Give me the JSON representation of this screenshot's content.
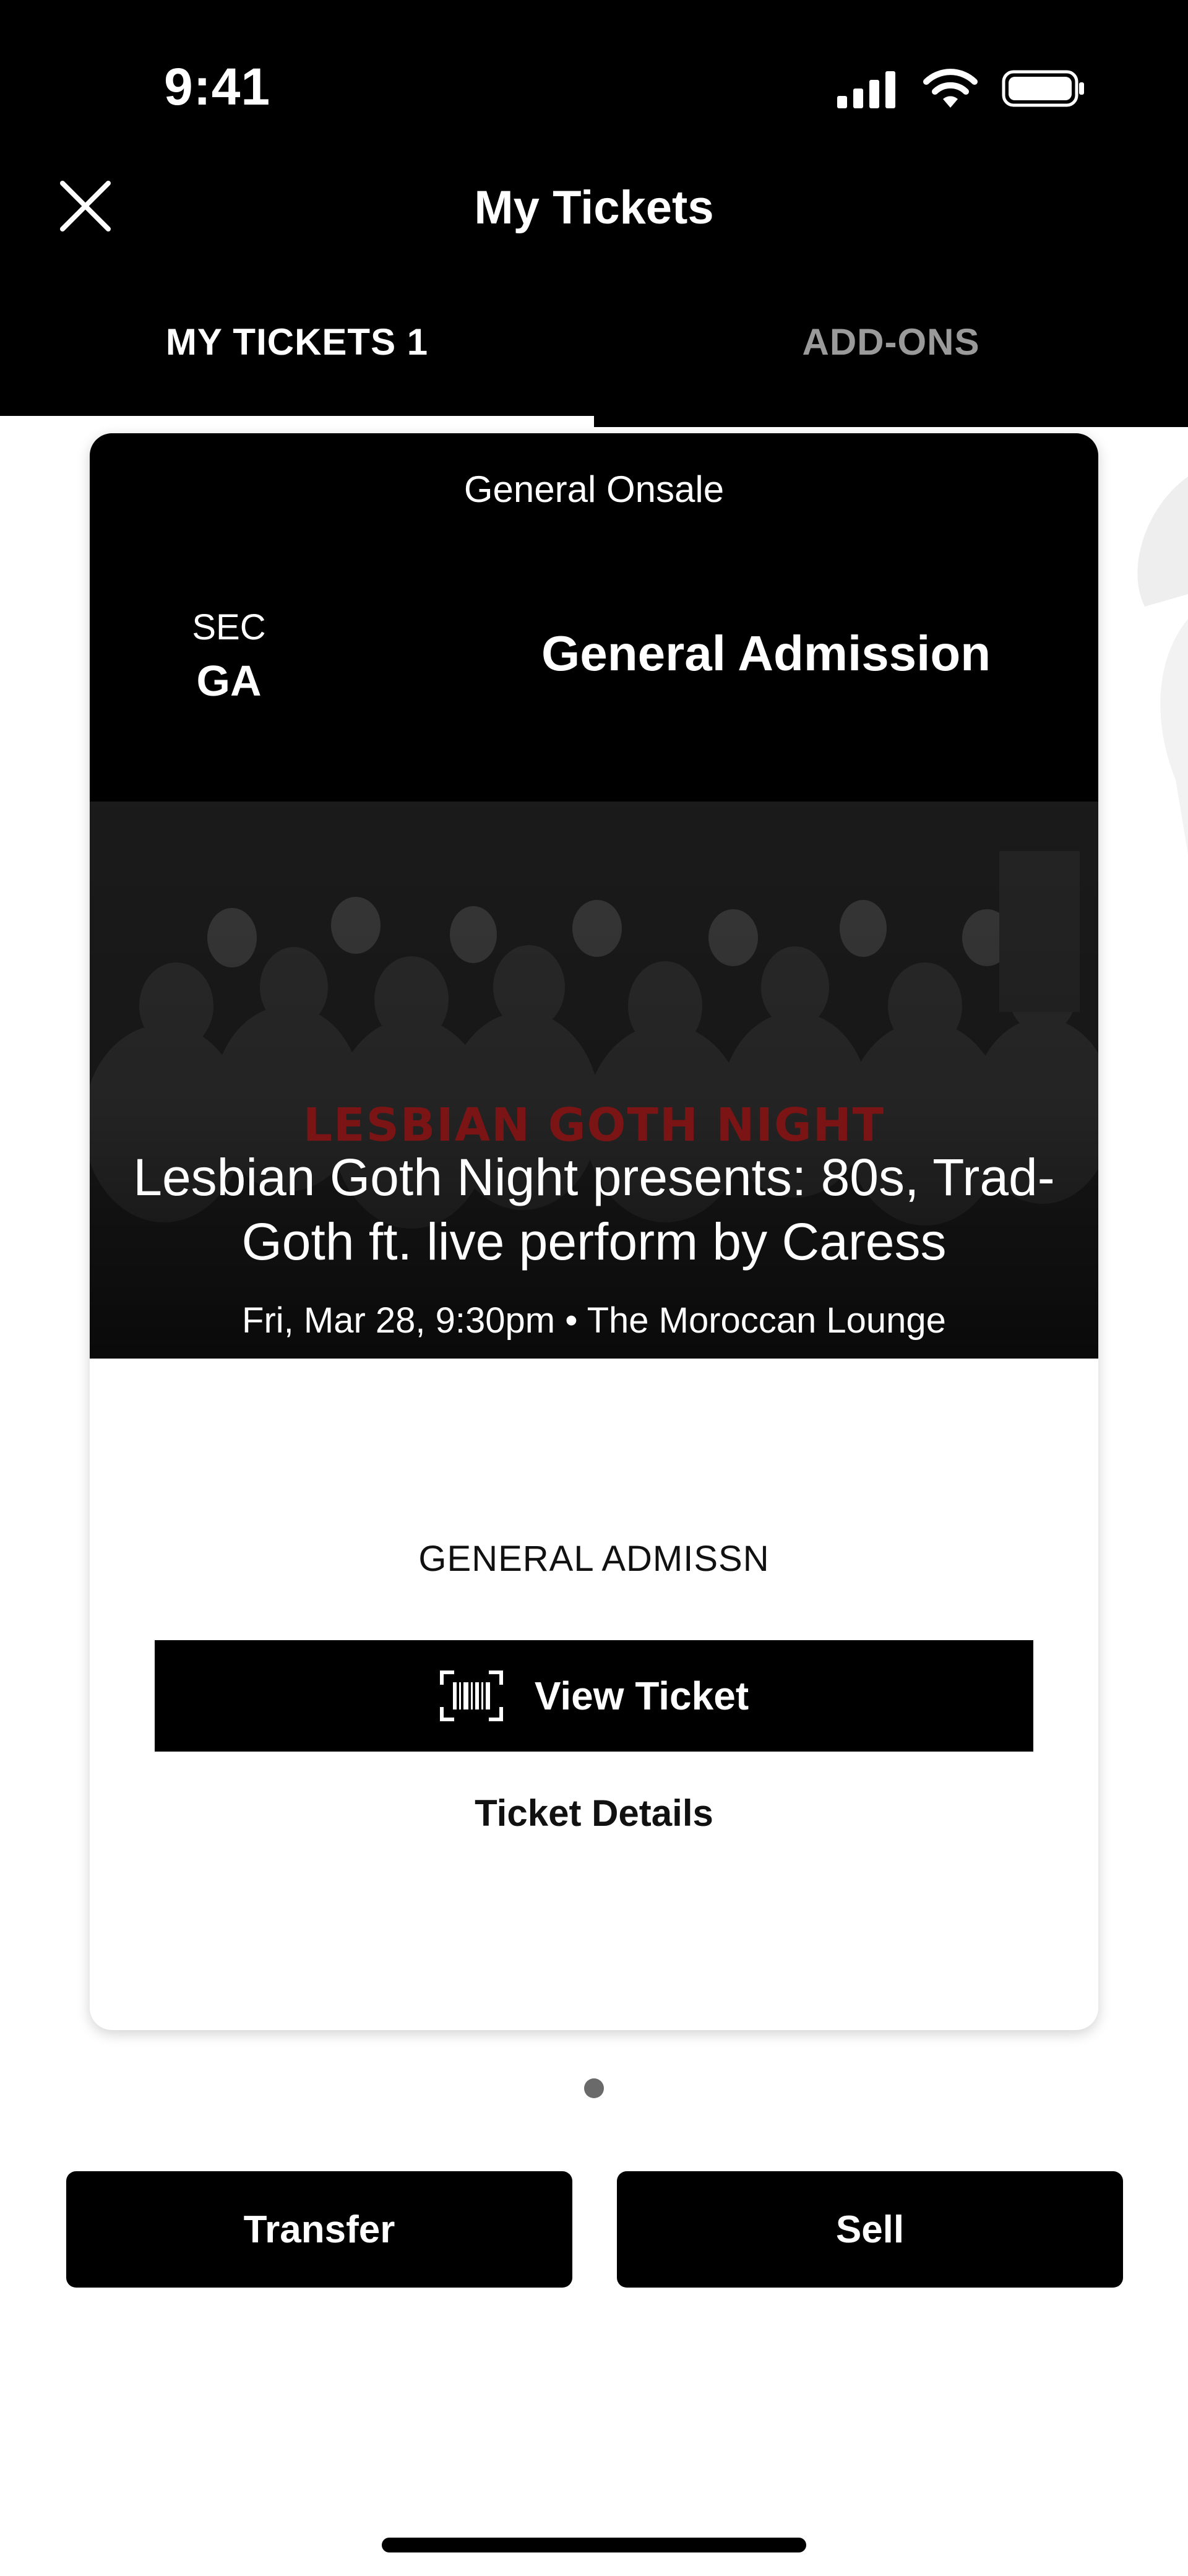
{
  "status_bar": {
    "time": "9:41"
  },
  "header": {
    "title": "My Tickets"
  },
  "tabs": [
    {
      "label": "MY TICKETS 1",
      "active": true
    },
    {
      "label": "ADD-ONS",
      "active": false
    }
  ],
  "ticket": {
    "onsale": "General Onsale",
    "section_label": "SEC",
    "section_value": "GA",
    "admission_title": "General Admission",
    "brand_text": "LESBIAN GOTH NIGHT",
    "event_title": "Lesbian Goth Night presents: 80s, Trad-Goth ft. live perform by Caress",
    "event_meta": "Fri, Mar 28, 9:30pm • The Moroccan Lounge",
    "admission_code": "GENERAL ADMISSN",
    "view_ticket_label": "View Ticket",
    "ticket_details_label": "Ticket Details"
  },
  "actions": {
    "transfer_label": "Transfer",
    "sell_label": "Sell"
  },
  "colors": {
    "background": "#ffffff",
    "header": "#000000",
    "brand_red": "#7b1414"
  }
}
